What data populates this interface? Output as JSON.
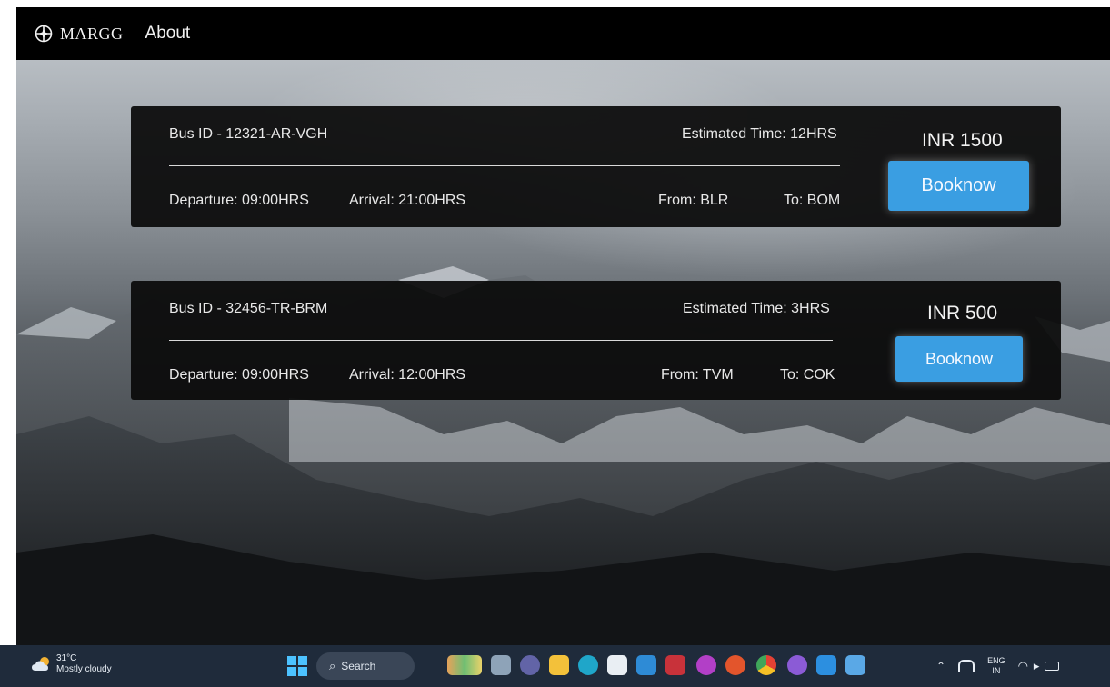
{
  "navbar": {
    "brand": "MARGG",
    "about": "About"
  },
  "buses": [
    {
      "bus_id": "Bus ID - 12321-AR-VGH",
      "estimated_time": "Estimated Time: 12HRS",
      "departure": "Departure: 09:00HRS",
      "arrival": "Arrival: 21:00HRS",
      "from": "From: BLR",
      "to": "To: BOM",
      "price": "INR 1500",
      "book_label": "Booknow"
    },
    {
      "bus_id": "Bus ID - 32456-TR-BRM",
      "estimated_time": "Estimated Time: 3HRS",
      "departure": "Departure: 09:00HRS",
      "arrival": "Arrival: 12:00HRS",
      "from": "From: TVM",
      "to": "To: COK",
      "price": "INR 500",
      "book_label": "Booknow"
    }
  ],
  "taskbar": {
    "weather_temp": "31°C",
    "weather_desc": "Mostly cloudy",
    "search_label": "Search",
    "lang_top": "ENG",
    "lang_bottom": "IN"
  },
  "colors": {
    "accent": "#3a9ee2",
    "navbar": "#000000",
    "card": "#0a0a0a",
    "taskbar": "#1f2b3b"
  }
}
